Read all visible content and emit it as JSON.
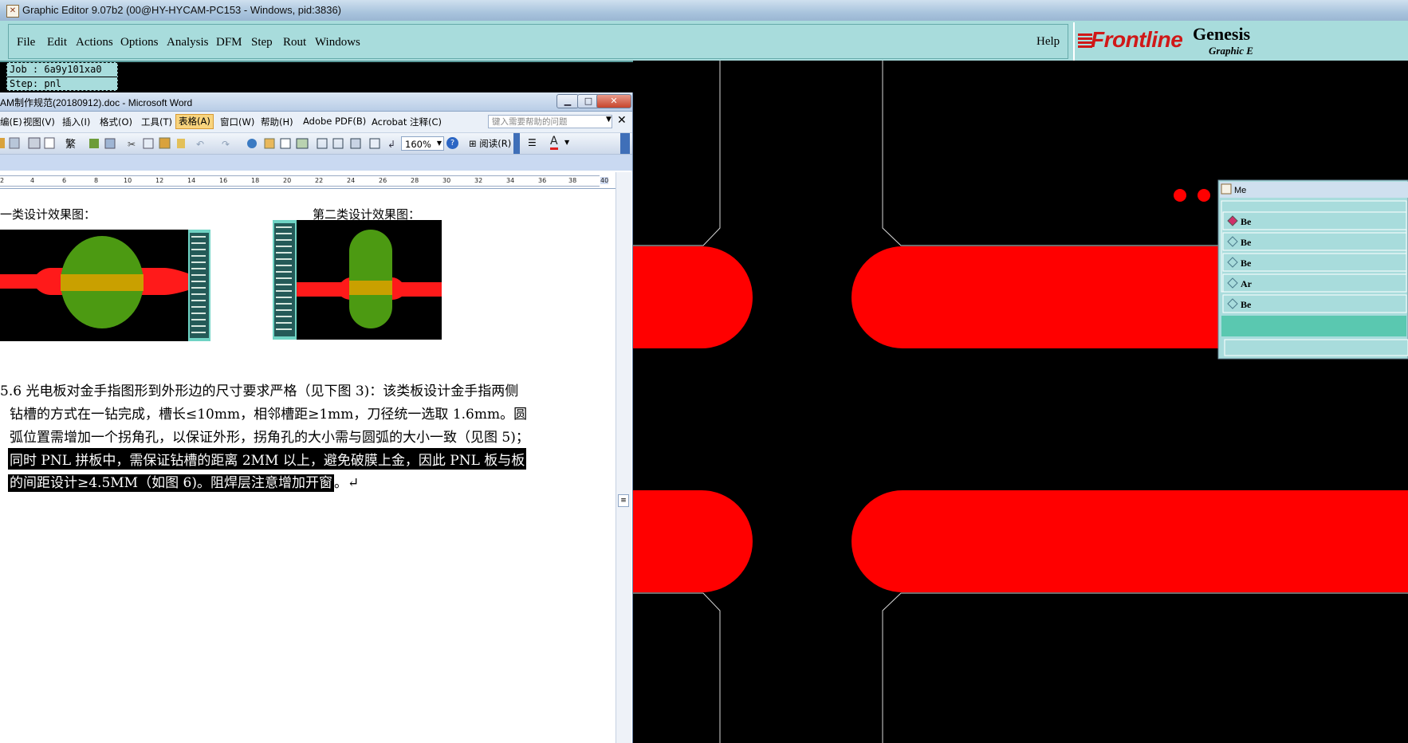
{
  "genesis": {
    "title": "Graphic Editor 9.07b2 (00@HY-HYCAM-PC153 - Windows, pid:3836)",
    "menu": [
      "File",
      "Edit",
      "Actions",
      "Options",
      "Analysis",
      "DFM",
      "Step",
      "Rout",
      "Windows"
    ],
    "help": "Help",
    "logo_brand": "Frontline",
    "logo_product": "Genesis",
    "logo_sub": "Graphic E",
    "job_label": "Job : 6a9y101xa0",
    "step_label": "Step: pnl",
    "side_panel_title": "Me",
    "side_panel_items": [
      "Be",
      "Be",
      "Be",
      "Ar",
      "Be"
    ],
    "colors": {
      "menu_bg": "#a8dcdc",
      "copper_red": "#ff0000",
      "canvas_bg": "#000000"
    }
  },
  "word": {
    "title": "AM制作规范(20180912).doc - Microsoft Word",
    "menu": [
      "编(E)",
      "视图(V)",
      "插入(I)",
      "格式(O)",
      "工具(T)",
      "表格(A)",
      "窗口(W)",
      "帮助(H)",
      "Adobe PDF(B)",
      "Acrobat 注释(C)"
    ],
    "help_placeholder": "键入需要帮助的问题",
    "zoom": "160%",
    "read_button": "阅读(R)",
    "ruler_numbers": [
      "2",
      "4",
      "6",
      "8",
      "10",
      "12",
      "14",
      "16",
      "18",
      "20",
      "22",
      "24",
      "26",
      "28",
      "30",
      "32",
      "34",
      "36",
      "38",
      "40"
    ],
    "caption_left": "一类设计效果图：",
    "caption_right": "第二类设计效果图：",
    "para_line1": "5.6  光电板对金手指图形到外形边的尺寸要求严格（见下图 3)：该类板设计金手指两侧",
    "para_line2": "钻槽的方式在一钻完成，槽长≤10mm，相邻槽距≥1mm，刀径统一选取  1.6mm。圆",
    "para_line3": "弧位置需增加一个拐角孔，以保证外形，拐角孔的大小需与圆弧的大小一致（见图 5)；",
    "para_line4": "同时 PNL 拼板中，需保证钻槽的距离 2MM 以上，避免破膜上金，因此 PNL  板与板",
    "para_line5_hl": "的间距设计≥4.5MM（如图 6)。阻焊层注意增加开窗",
    "para_line5_end": "。↵"
  }
}
